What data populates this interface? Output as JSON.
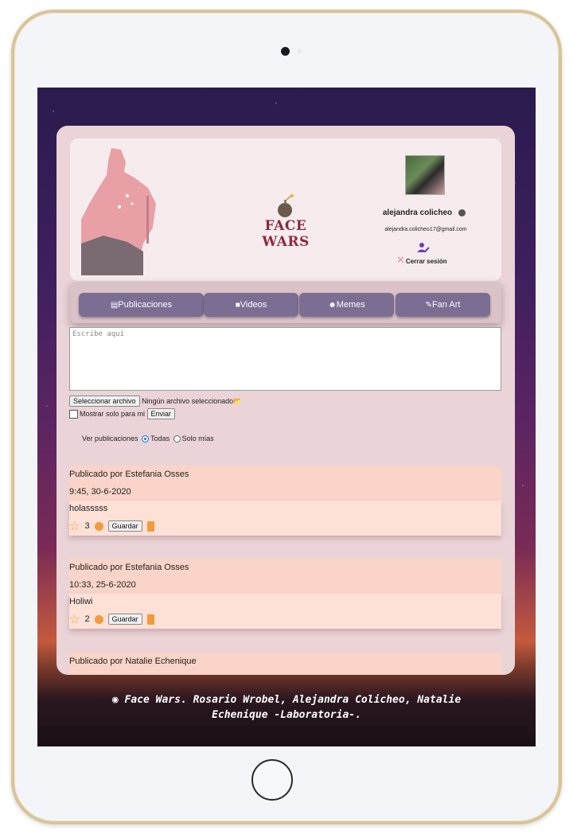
{
  "header": {
    "logo_text": "FACE WARS",
    "user_name": "alejandra colicheo",
    "user_email": "alejandra.colicheo17@gmail.com",
    "logout_label": "Cerrar sesión"
  },
  "menu": {
    "tabs": [
      {
        "label": "Publicaciones",
        "icon": "news-icon"
      },
      {
        "label": "Videos",
        "icon": "video-icon"
      },
      {
        "label": "Memes",
        "icon": "smile-icon"
      },
      {
        "label": "Fan Art",
        "icon": "brush-icon"
      }
    ]
  },
  "composer": {
    "placeholder": "Escribe aquí",
    "file_button": "Seleccionar archivo",
    "file_status": "Ningún archivo seleccionado",
    "private_label": "Mostrar solo para mi",
    "send_button": "Enviar"
  },
  "filter": {
    "label": "Ver publicaciones",
    "options": [
      "Todas",
      "Solo mías"
    ],
    "selected": "Todas"
  },
  "posts": [
    {
      "author": "Publicado por Estefania Osses",
      "date": "9:45, 30-6-2020",
      "text": "holasssss",
      "likes": "3",
      "save_label": "Guardar"
    },
    {
      "author": "Publicado por Estefania Osses",
      "date": "10:33, 25-6-2020",
      "text": "Holiwi",
      "likes": "2",
      "save_label": "Guardar"
    },
    {
      "author": "Publicado por Natalie Echenique"
    }
  ],
  "footer": {
    "line1": "Face Wars. Rosario Wrobel, Alejandra Colicheo, Natalie",
    "line2": "Echenique -Laboratoria-."
  }
}
